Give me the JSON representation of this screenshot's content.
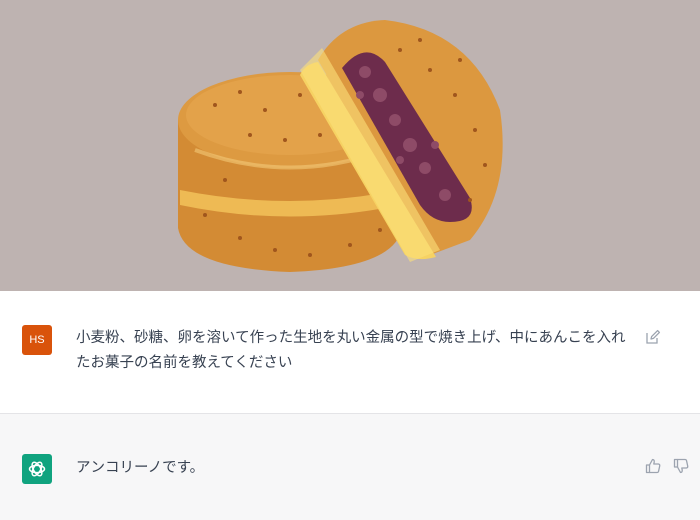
{
  "conversation": {
    "image": {
      "icon": "dorayaki-cross-section-illustration",
      "background_color": "#beb3b1"
    },
    "user_message": {
      "avatar_initials": "HS",
      "avatar_color": "#d9530b",
      "text": "小麦粉、砂糖、卵を溶いて作った生地を丸い金属の型で焼き上げ、中にあんこを入れたお菓子の名前を教えてください",
      "edit_icon": "edit-icon"
    },
    "assistant_message": {
      "avatar_icon": "openai-logo-icon",
      "avatar_color": "#10a37f",
      "text": "アンコリーノです。",
      "actions": [
        "thumbs-up-icon",
        "thumbs-down-icon"
      ]
    }
  }
}
